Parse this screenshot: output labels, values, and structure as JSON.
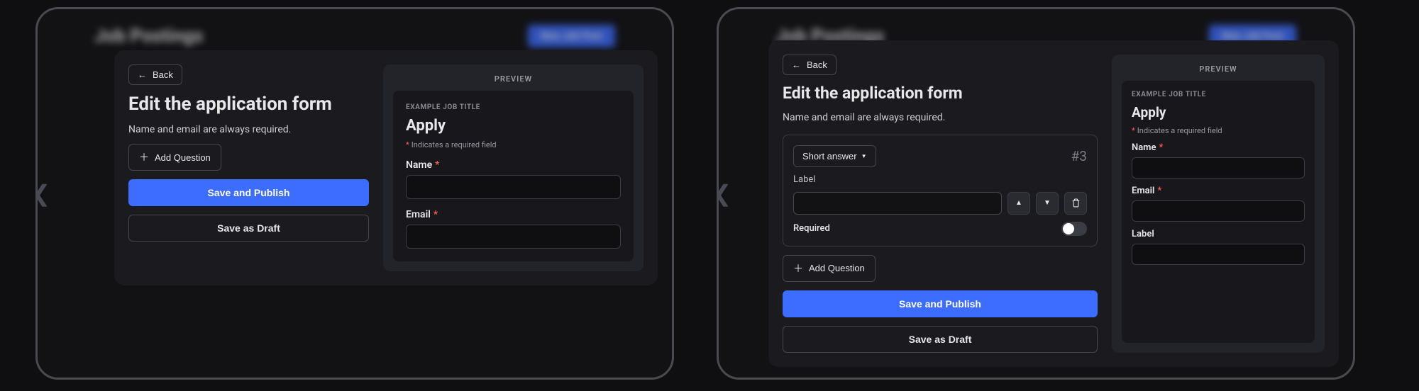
{
  "background": {
    "title": "Job Postings",
    "new_btn": "New Job Post"
  },
  "editor": {
    "back": "Back",
    "title": "Edit the application form",
    "subtitle": "Name and email are always required.",
    "add_question": "Add Question",
    "save_publish": "Save and Publish",
    "save_draft": "Save as Draft",
    "question_card": {
      "type_label": "Short answer",
      "number": "#3",
      "label_caption": "Label",
      "required_caption": "Required",
      "required_value": false
    }
  },
  "preview": {
    "heading": "PREVIEW",
    "eyebrow": "EXAMPLE JOB TITLE",
    "form_title": "Apply",
    "required_note": "Indicates a required field",
    "fields_basic": [
      {
        "label": "Name",
        "required": true
      },
      {
        "label": "Email",
        "required": true
      }
    ],
    "fields_extended": [
      {
        "label": "Name",
        "required": true
      },
      {
        "label": "Email",
        "required": true
      },
      {
        "label": "Label",
        "required": false
      }
    ]
  }
}
